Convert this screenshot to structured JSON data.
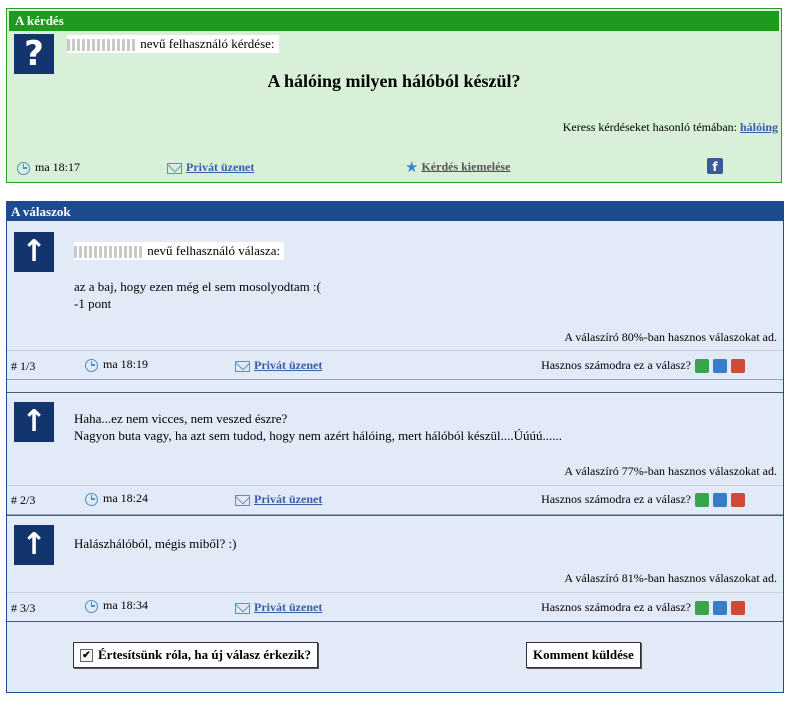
{
  "question": {
    "header": "A kérdés",
    "user_suffix": "nevű felhasználó kérdése:",
    "title": "A hálóing milyen hálóból készül?",
    "search_similar_prefix": "Keress kérdéseket hasonló témában:",
    "search_similar_tag": "hálóing",
    "time": "ma 18:17",
    "private_message": "Privát üzenet",
    "highlight": "Kérdés kiemelése",
    "facebook_letter": "f"
  },
  "answers_section": {
    "header": "A válaszok",
    "user_suffix": "nevű felhasználó válasza:",
    "useful_question": "Hasznos számodra ez a válasz?",
    "private_message": "Privát üzenet",
    "items": [
      {
        "lines": [
          "az a baj, hogy ezen még el sem mosolyodtam :(",
          "-1 pont"
        ],
        "useful_rate": "A válaszíró 80%-ban hasznos válaszokat ad.",
        "number": "# 1/3",
        "time": "ma 18:19"
      },
      {
        "lines": [
          "Haha...ez nem vicces, nem veszed észre?",
          "Nagyon buta vagy, ha azt sem tudod, hogy nem azért hálóing, mert hálóból készül....Úúúú......"
        ],
        "useful_rate": "A válaszíró 77%-ban hasznos válaszokat ad.",
        "number": "# 2/3",
        "time": "ma 18:24"
      },
      {
        "lines": [
          "Halászhálóból, mégis miből? :)"
        ],
        "useful_rate": "A válaszíró 81%-ban hasznos válaszokat ad.",
        "number": "# 3/3",
        "time": "ma 18:34"
      }
    ]
  },
  "actions": {
    "notify_label": "Értesítsünk róla, ha új válasz érkezik?",
    "notify_checked": true,
    "comment_button": "Komment küldése"
  },
  "colors": {
    "question_header": "#1e9a1e",
    "question_bg": "#d8f0d8",
    "answers_header": "#1d4b8f",
    "answers_bg": "#e2e9f7"
  }
}
